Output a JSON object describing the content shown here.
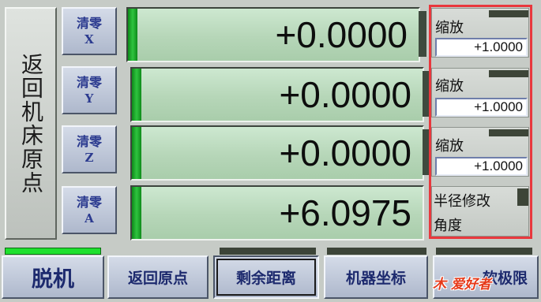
{
  "home": {
    "label": "返回机床原点"
  },
  "axes": [
    {
      "zero_line1": "清零",
      "zero_line2": "X",
      "value": "+0.0000"
    },
    {
      "zero_line1": "清零",
      "zero_line2": "Y",
      "value": "+0.0000"
    },
    {
      "zero_line1": "清零",
      "zero_line2": "Z",
      "value": "+0.0000"
    },
    {
      "zero_line1": "清零",
      "zero_line2": "A",
      "value": "+6.0975"
    }
  ],
  "scale": [
    {
      "label": "缩放",
      "value": "+1.0000"
    },
    {
      "label": "缩放",
      "value": "+1.0000"
    },
    {
      "label": "缩放",
      "value": "+1.0000"
    }
  ],
  "radius": {
    "line1": "半径修改",
    "line2": "角度"
  },
  "bottom": {
    "offline": "脱机",
    "return_home": "返回原点",
    "remaining": "剩余距离",
    "machine_coords": "机器坐标",
    "soft_limit_partial": "软极限"
  },
  "watermark": "木 爱好者",
  "colors": {
    "display_green": "#b6d6b8",
    "led_green": "#1ee02e",
    "highlight_red": "#e8383d"
  }
}
